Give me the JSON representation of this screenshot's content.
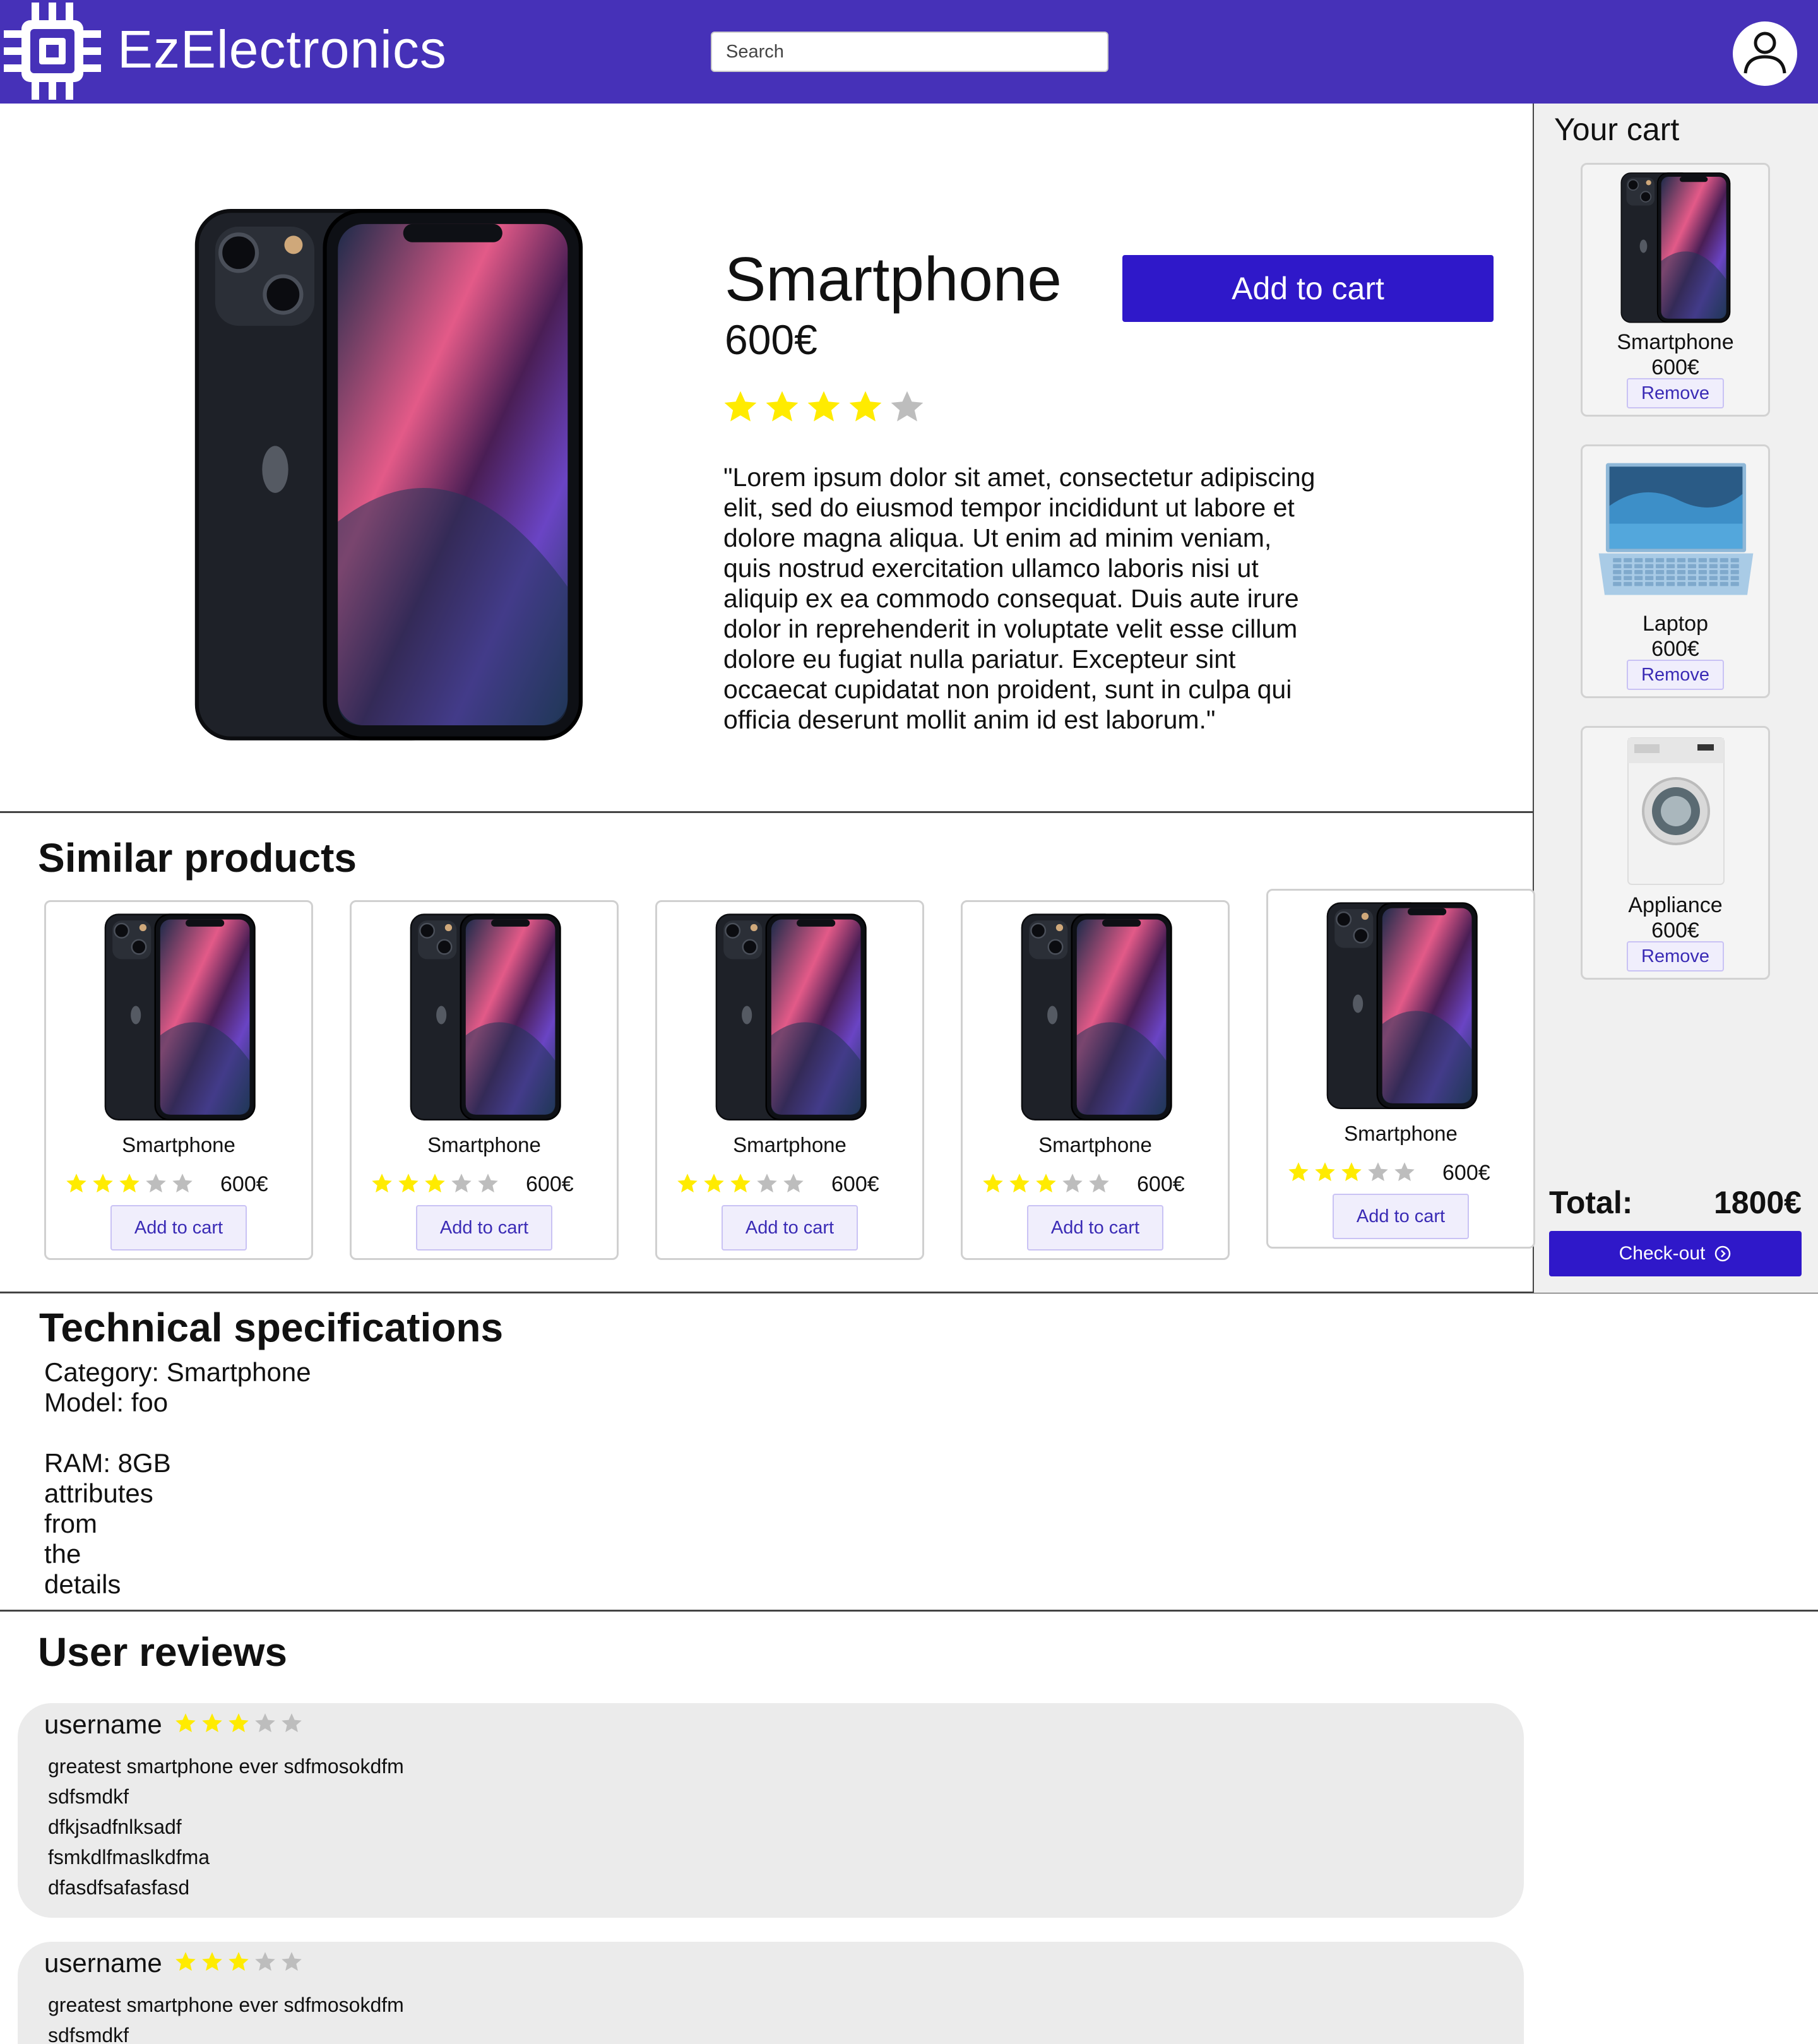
{
  "header": {
    "brand": "EzElectronics",
    "search_placeholder": "Search"
  },
  "product": {
    "title": "Smartphone",
    "price": "600€",
    "rating": 4,
    "rating_max": 5,
    "add_to_cart_label": "Add to cart",
    "description": "\"Lorem ipsum dolor sit amet, consectetur adipiscing elit, sed do eiusmod tempor incididunt ut labore et dolore magna aliqua. Ut enim ad minim veniam, quis nostrud exercitation ullamco laboris nisi ut aliquip ex ea commodo consequat. Duis aute irure dolor in reprehenderit in voluptate velit esse cillum dolore eu fugiat nulla pariatur. Excepteur sint occaecat cupidatat non proident, sunt in culpa qui officia deserunt mollit anim id est laborum.\""
  },
  "cart": {
    "title": "Your cart",
    "items": [
      {
        "name": "Smartphone",
        "price": "600€",
        "remove_label": "Remove",
        "image": "smartphone"
      },
      {
        "name": "Laptop",
        "price": "600€",
        "remove_label": "Remove",
        "image": "laptop"
      },
      {
        "name": "Appliance",
        "price": "600€",
        "remove_label": "Remove",
        "image": "washing-machine"
      }
    ],
    "total_label": "Total:",
    "total_value": "1800€",
    "checkout_label": "Check-out"
  },
  "similar": {
    "title": "Similar products",
    "items": [
      {
        "name": "Smartphone",
        "rating": 3,
        "price": "600€",
        "button": "Add to cart"
      },
      {
        "name": "Smartphone",
        "rating": 3,
        "price": "600€",
        "button": "Add to cart"
      },
      {
        "name": "Smartphone",
        "rating": 3,
        "price": "600€",
        "button": "Add to cart"
      },
      {
        "name": "Smartphone",
        "rating": 3,
        "price": "600€",
        "button": "Add to cart"
      },
      {
        "name": "Smartphone",
        "rating": 3,
        "price": "600€",
        "button": "Add to cart"
      }
    ]
  },
  "specs": {
    "title": "Technical specifications",
    "lines": [
      "Category: Smartphone",
      "Model: foo",
      "",
      "RAM: 8GB",
      "attributes",
      "from",
      "the",
      "details"
    ]
  },
  "reviews": {
    "title": "User reviews",
    "items": [
      {
        "username": "username",
        "rating": 3,
        "lines": [
          "greatest smartphone ever sdfmosokdfm",
          "sdfsmdkf",
          "dfkjsadfnlksadf",
          "fsmkdlfmaslkdfma",
          "dfasdfsafasfasd"
        ]
      },
      {
        "username": "username",
        "rating": 3,
        "lines": [
          "greatest smartphone ever sdfmosokdfm",
          "sdfsmdkf"
        ]
      }
    ]
  },
  "colors": {
    "brand": "#4631B8",
    "primary_button": "#2F18C9",
    "star_filled": "#FFEB00",
    "star_empty": "#BDBDBD"
  }
}
